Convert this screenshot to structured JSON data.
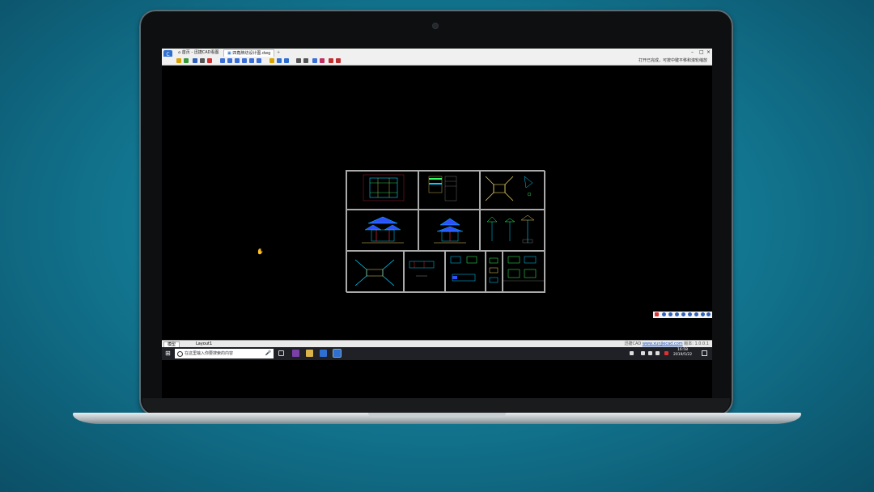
{
  "window": {
    "home_tab_label": "首页 - 迅捷CAD看图",
    "doc_tab_label": "四角牌坊设计图.dwg",
    "add_tab_label": "+",
    "minimize_label": "–",
    "maximize_label": "□",
    "close_label": "×"
  },
  "toolbar": {
    "hint_text": "打开已完成，可按中键平移和滚轮缩放",
    "icons": [
      "open-icon",
      "tree-icon",
      "save-icon",
      "print-icon",
      "pdf-icon",
      "pan-icon",
      "zoom-realtime-icon",
      "zoom-window-icon",
      "zoom-in-icon",
      "zoom-out-icon",
      "zoom-extents-icon",
      "layer-icon",
      "properties-icon",
      "3d-icon",
      "measure-line-icon",
      "measure-area-icon",
      "measure-angle-icon",
      "annotate-icon",
      "undo-icon",
      "redo-icon"
    ]
  },
  "layout_tabs": {
    "model_label": "模型",
    "layout1_label": "Layout1"
  },
  "status": {
    "version_prefix": "迅捷CAD",
    "version_link": "www.xunjiecad.com",
    "version_suffix": "版本: 1.0.0.1"
  },
  "taskbar": {
    "start_label": "⊞",
    "search_placeholder": "在这里输入你要搜索的内容",
    "mic_label": "🎤",
    "time": "16:58",
    "date": "2019/5/22"
  },
  "colors": {
    "canvas_bg": "#000000",
    "drawing_line": "#aaaaaa",
    "cad_cyan": "#00d0ff",
    "cad_blue": "#2f4fff",
    "cad_yellow": "#e8d060",
    "cad_green": "#30ff60",
    "cad_red": "#ff3040"
  }
}
